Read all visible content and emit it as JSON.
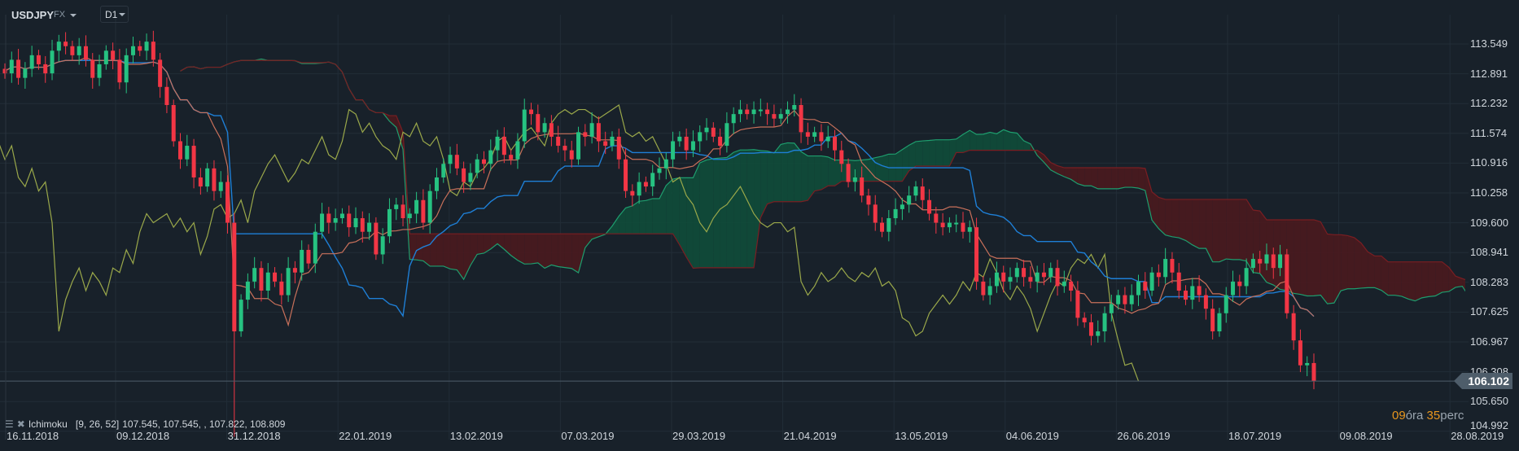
{
  "header": {
    "symbol": "USDJPY",
    "market": "FX",
    "timeframe": "D1"
  },
  "indicator_legend": {
    "name": "Ichimoku",
    "params": "[9, 26, 52]",
    "values": "107.545,  107.545,  , 107.822,  108.809"
  },
  "countdown": {
    "hours": "09",
    "hours_unit": "óra",
    "minutes": "35",
    "minutes_unit": "perc"
  },
  "current_price": "106.102",
  "colors": {
    "background": "#18212a",
    "up": "#26c281",
    "down": "#f23645",
    "tenkan": "#c8705a",
    "kijun": "#1e7fd6",
    "chikou": "#9aa84a",
    "cloud_bull": "#0f4d3a",
    "cloud_bear": "#4a1a1e"
  },
  "chart_data": {
    "type": "candlestick",
    "title": "USDJPY",
    "indicator": "Ichimoku [9, 26, 52]",
    "y_ticks": [
      "113.549",
      "112.891",
      "112.232",
      "111.574",
      "110.916",
      "110.258",
      "109.600",
      "108.941",
      "108.283",
      "107.625",
      "106.967",
      "106.308",
      "105.650",
      "104.992"
    ],
    "ylim": [
      104.992,
      113.549
    ],
    "x_ticks": [
      "16.11.2018",
      "09.12.2018",
      "31.12.2018",
      "22.01.2019",
      "13.02.2019",
      "07.03.2019",
      "29.03.2019",
      "21.04.2019",
      "13.05.2019",
      "04.06.2019",
      "26.06.2019",
      "18.07.2019",
      "09.08.2019",
      "28.08.2019"
    ],
    "grid": true,
    "closes": [
      112.9,
      113.2,
      112.8,
      113.0,
      113.3,
      113.1,
      112.9,
      113.4,
      113.6,
      113.5,
      113.3,
      113.5,
      113.2,
      112.8,
      113.1,
      113.4,
      113.2,
      112.7,
      113.3,
      113.5,
      113.4,
      113.6,
      113.2,
      112.6,
      112.2,
      111.4,
      111.0,
      111.3,
      110.6,
      110.4,
      110.8,
      110.3,
      110.5,
      109.6,
      107.2,
      107.9,
      108.3,
      108.6,
      108.1,
      108.5,
      108.3,
      108.0,
      108.6,
      108.5,
      109.0,
      108.7,
      109.4,
      109.8,
      109.6,
      109.7,
      109.8,
      109.5,
      109.7,
      109.4,
      109.6,
      108.9,
      109.3,
      109.9,
      110.0,
      109.7,
      109.8,
      110.1,
      109.6,
      110.3,
      110.6,
      110.9,
      111.1,
      110.8,
      110.5,
      110.7,
      111.0,
      110.9,
      111.2,
      111.5,
      111.1,
      111.0,
      111.4,
      112.1,
      112.0,
      111.6,
      111.8,
      111.5,
      111.3,
      111.2,
      111.0,
      111.6,
      111.5,
      111.8,
      111.4,
      111.3,
      111.5,
      111.0,
      110.3,
      110.2,
      110.5,
      110.4,
      110.7,
      110.8,
      111.0,
      111.4,
      111.5,
      111.2,
      111.4,
      111.6,
      111.7,
      111.5,
      111.3,
      111.8,
      112.0,
      112.1,
      112.0,
      112.1,
      112.1,
      112.0,
      111.9,
      112.0,
      112.1,
      112.2,
      111.6,
      111.5,
      111.6,
      111.4,
      111.5,
      111.2,
      110.9,
      110.5,
      110.6,
      110.2,
      110.0,
      109.6,
      109.4,
      109.7,
      109.9,
      110.0,
      110.2,
      110.4,
      110.1,
      109.8,
      109.6,
      109.5,
      109.6,
      109.6,
      109.4,
      109.5,
      108.3,
      108.0,
      108.2,
      108.5,
      108.3,
      108.4,
      108.6,
      108.4,
      108.3,
      108.5,
      108.4,
      108.6,
      108.2,
      108.3,
      108.1,
      107.5,
      107.4,
      107.1,
      107.2,
      107.6,
      107.8,
      108.0,
      107.8,
      108.0,
      108.3,
      108.1,
      108.5,
      108.4,
      108.8,
      108.5,
      108.1,
      107.9,
      108.2,
      108.0,
      107.7,
      107.2,
      107.6,
      108.0,
      108.3,
      108.2,
      108.6,
      108.8,
      108.7,
      108.9,
      108.6,
      108.9,
      107.6,
      107.0,
      106.45,
      106.5,
      106.102
    ],
    "extreme_lows": [
      {
        "index": 34,
        "low": 104.87
      }
    ],
    "last_price": 106.102
  }
}
